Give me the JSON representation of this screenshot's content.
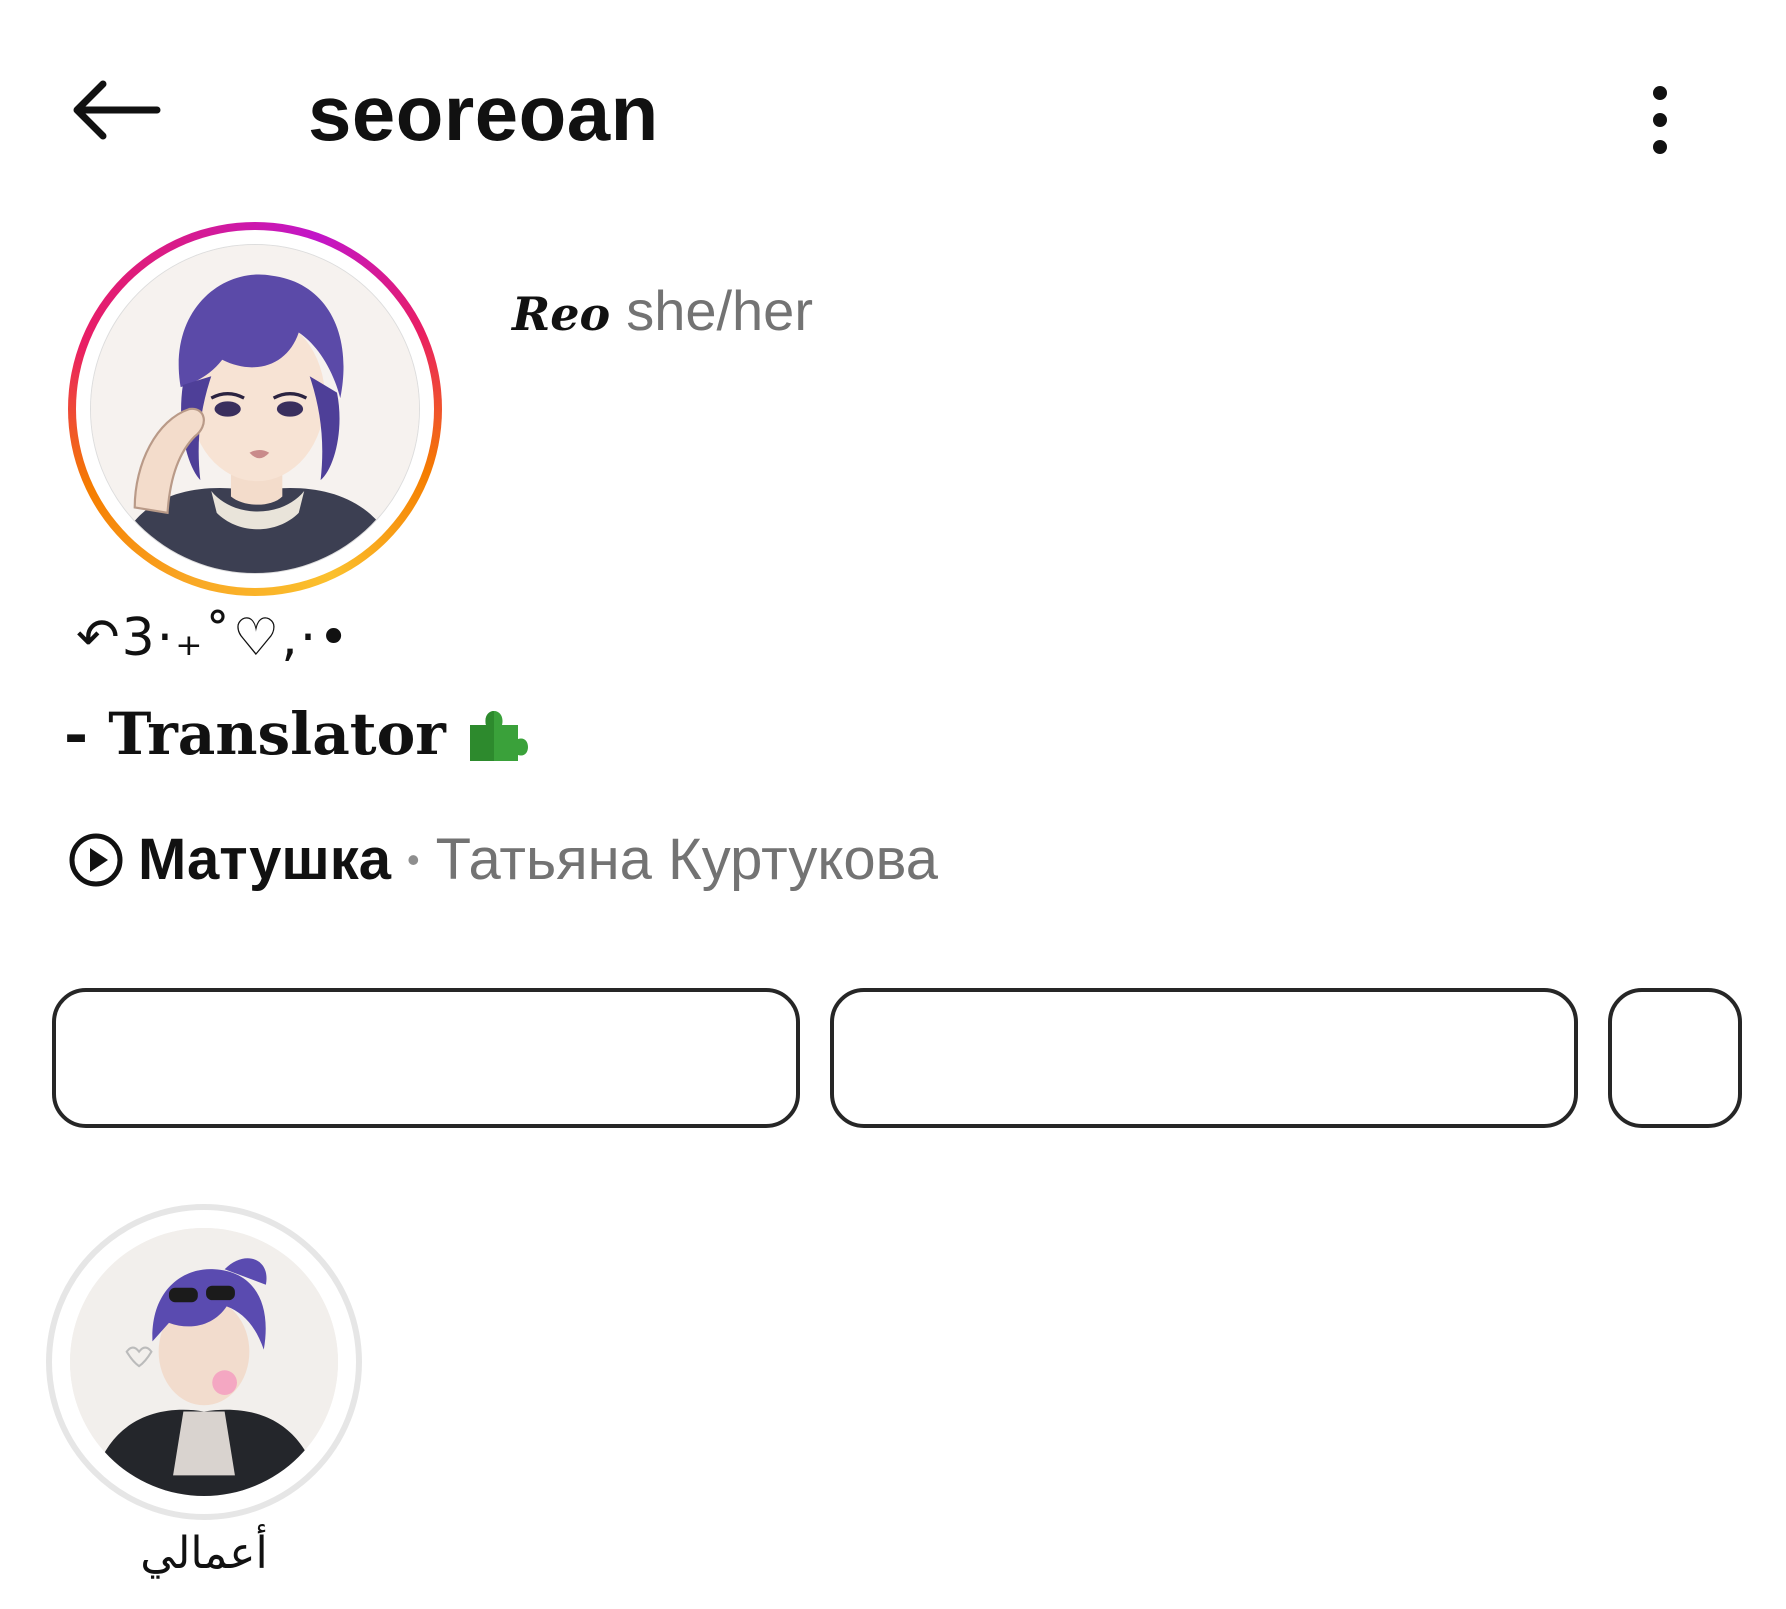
{
  "header": {
    "username": "seoreoan",
    "back_icon": "arrow-left-icon",
    "more_icon": "more-vertical-icon"
  },
  "profile": {
    "display_name": "𝒭ℯℴ Reo",
    "name_script": "Reo",
    "pronouns": "she/her",
    "story_ring_colors": [
      "#f9a825",
      "#e91e63",
      "#c216c9"
    ]
  },
  "bio": {
    "decoration": "↶3·₊˚♡,·•",
    "line1": "- Translator",
    "line1_emoji": "puzzle-piece-icon"
  },
  "music": {
    "icon": "play-circle-icon",
    "title": "Матушка",
    "separator": "•",
    "artist": "Татьяна Куртукова"
  },
  "buttons": [
    {
      "label": ""
    },
    {
      "label": ""
    },
    {
      "label": ""
    }
  ],
  "highlights": [
    {
      "label": "أعمالي"
    }
  ]
}
